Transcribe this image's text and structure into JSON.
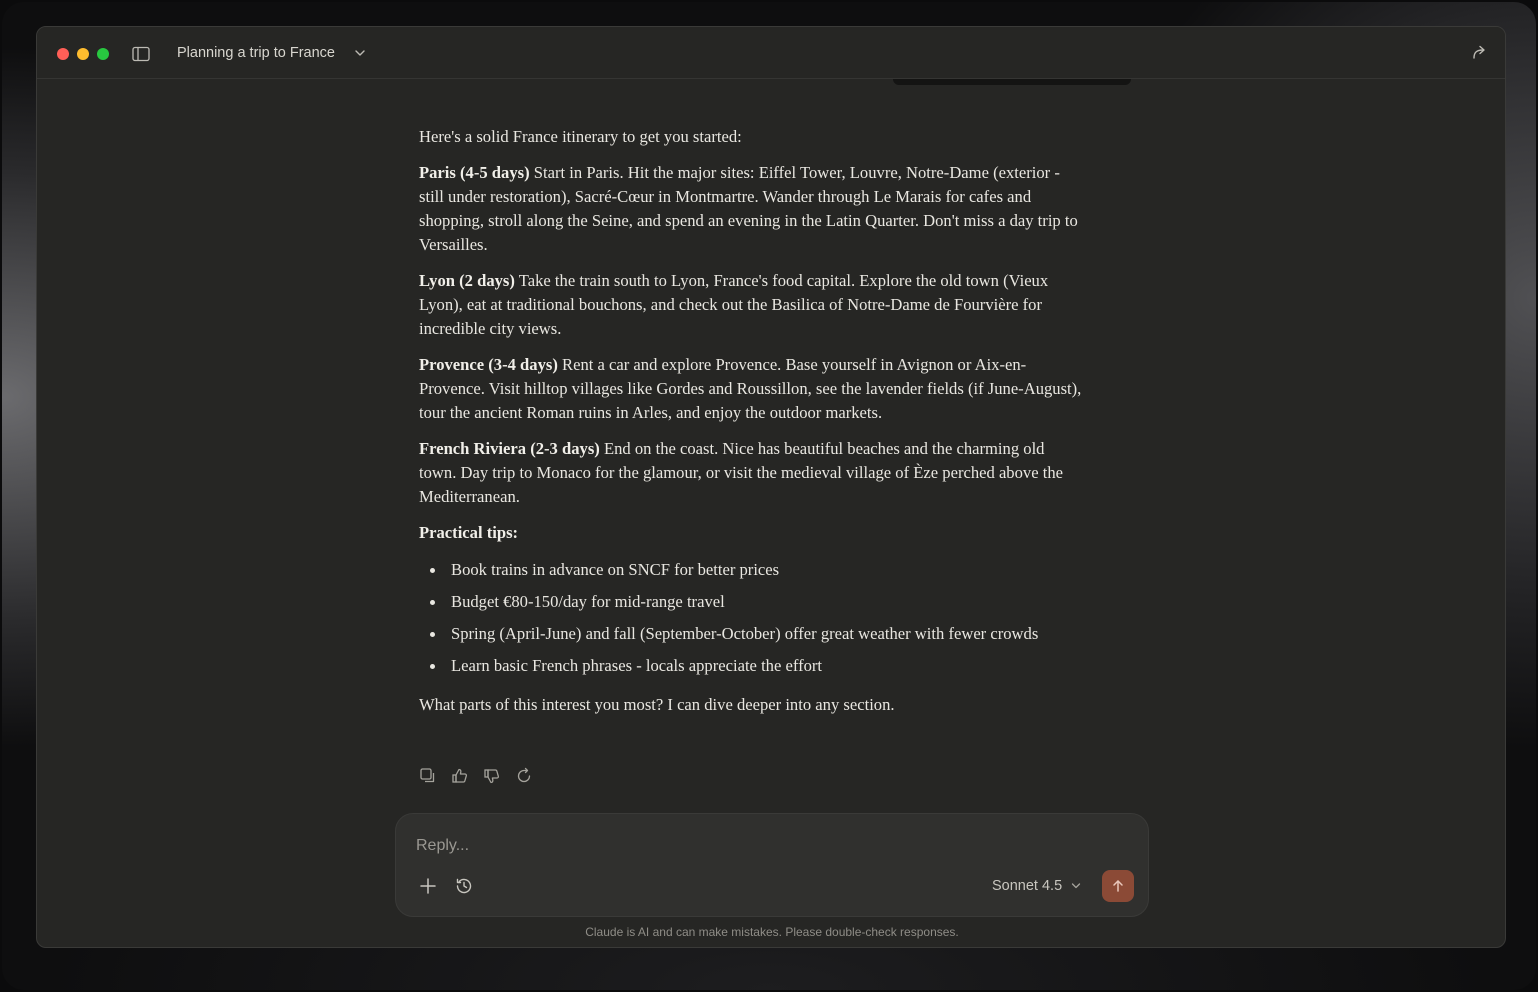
{
  "window": {
    "conversation_title": "Planning a trip to France"
  },
  "message": {
    "intro": "Here's a solid France itinerary to get you started:",
    "sections": [
      {
        "heading": "Paris (4-5 days)",
        "body": " Start in Paris. Hit the major sites: Eiffel Tower, Louvre, Notre-Dame (exterior - still under restoration), Sacré-Cœur in Montmartre. Wander through Le Marais for cafes and shopping, stroll along the Seine, and spend an evening in the Latin Quarter. Don't miss a day trip to Versailles."
      },
      {
        "heading": "Lyon (2 days)",
        "body": " Take the train south to Lyon, France's food capital. Explore the old town (Vieux Lyon), eat at traditional bouchons, and check out the Basilica of Notre-Dame de Fourvière for incredible city views."
      },
      {
        "heading": "Provence (3-4 days)",
        "body": " Rent a car and explore Provence. Base yourself in Avignon or Aix-en-Provence. Visit hilltop villages like Gordes and Roussillon, see the lavender fields (if June-August), tour the ancient Roman ruins in Arles, and enjoy the outdoor markets."
      },
      {
        "heading": "French Riviera (2-3 days)",
        "body": " End on the coast. Nice has beautiful beaches and the charming old town. Day trip to Monaco for the glamour, or visit the medieval village of Èze perched above the Mediterranean."
      }
    ],
    "tips_heading": "Practical tips:",
    "tips": [
      "Book trains in advance on SNCF for better prices",
      "Budget €80-150/day for mid-range travel",
      "Spring (April-June) and fall (September-October) offer great weather with fewer crowds",
      "Learn basic French phrases - locals appreciate the effort"
    ],
    "closing": "What parts of this interest you most? I can dive deeper into any section."
  },
  "composer": {
    "placeholder": "Reply...",
    "model": "Sonnet 4.5"
  },
  "disclaimer": "Claude is AI and can make mistakes. Please double-check responses.",
  "colors": {
    "accent": "#8b4a36",
    "window_bg": "#262624",
    "composer_bg": "#30302e"
  },
  "icons": {
    "sidebar": "sidebar-toggle-icon",
    "share": "share-icon",
    "copy": "copy-icon",
    "thumbs_up": "thumbs-up-icon",
    "thumbs_down": "thumbs-down-icon",
    "retry": "retry-icon",
    "plus": "plus-icon",
    "history": "history-icon",
    "send": "arrow-up-icon"
  }
}
